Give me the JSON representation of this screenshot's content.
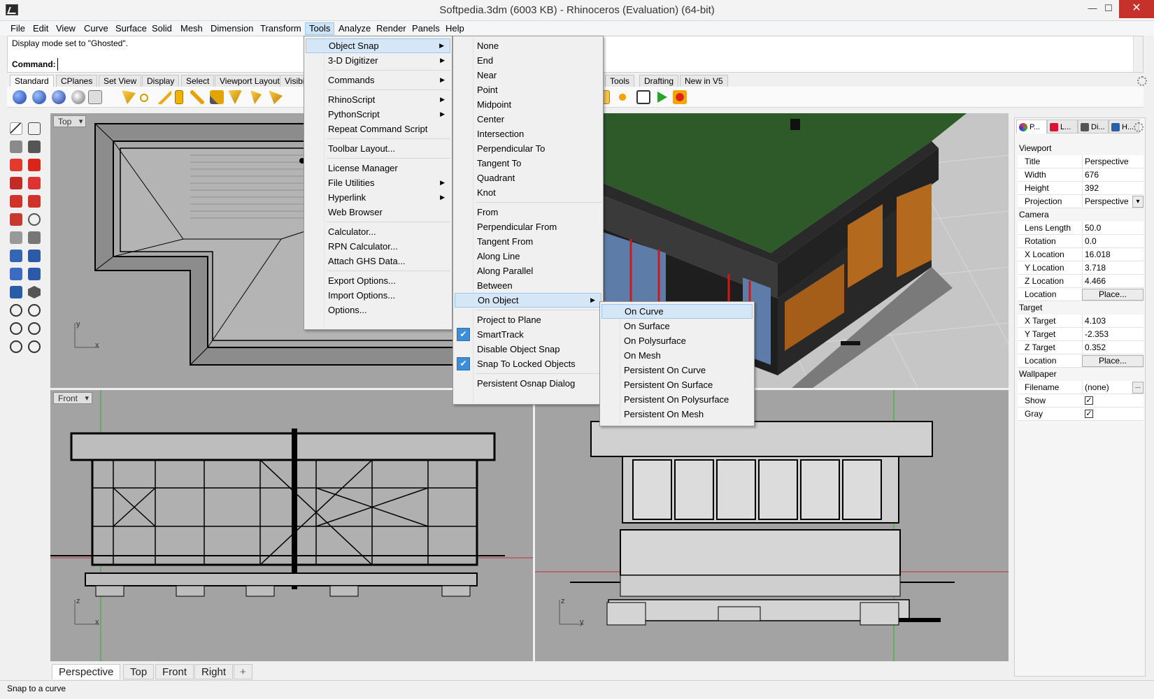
{
  "window": {
    "title": "Softpedia.3dm (6003 KB) - Rhinoceros (Evaluation) (64-bit)",
    "minimize_glyph": "—",
    "maximize_glyph": "☐",
    "close_glyph": "✕"
  },
  "menubar": [
    "File",
    "Edit",
    "View",
    "Curve",
    "Surface",
    "Solid",
    "Mesh",
    "Dimension",
    "Transform",
    "Tools",
    "Analyze",
    "Render",
    "Panels",
    "Help"
  ],
  "command": {
    "history": "Display mode set to \"Ghosted\".",
    "prompt": "Command:",
    "value": ""
  },
  "toolbar_tabs": [
    "Standard",
    "CPlanes",
    "Set View",
    "Display",
    "Select",
    "Viewport Layout",
    "Visibility",
    "Tools",
    "Drafting",
    "New in V5"
  ],
  "tools_menu": {
    "items": [
      {
        "label": "Object Snap",
        "submenu": true,
        "highlighted": true
      },
      {
        "label": "3-D Digitizer",
        "submenu": true
      },
      {
        "sep": true
      },
      {
        "label": "Commands",
        "submenu": true
      },
      {
        "sep": true
      },
      {
        "label": "RhinoScript",
        "submenu": true
      },
      {
        "label": "PythonScript",
        "submenu": true
      },
      {
        "label": "Repeat Command Script"
      },
      {
        "sep": true
      },
      {
        "label": "Toolbar Layout..."
      },
      {
        "sep": true
      },
      {
        "label": "License Manager"
      },
      {
        "label": "File Utilities",
        "submenu": true
      },
      {
        "label": "Hyperlink",
        "submenu": true
      },
      {
        "label": "Web Browser"
      },
      {
        "sep": true
      },
      {
        "label": "Calculator..."
      },
      {
        "label": "RPN Calculator..."
      },
      {
        "label": "Attach GHS Data..."
      },
      {
        "sep": true
      },
      {
        "label": "Export Options..."
      },
      {
        "label": "Import Options..."
      },
      {
        "label": "Options..."
      }
    ]
  },
  "osnap_menu": {
    "items": [
      {
        "label": "None"
      },
      {
        "label": "End"
      },
      {
        "label": "Near"
      },
      {
        "label": "Point"
      },
      {
        "label": "Midpoint"
      },
      {
        "label": "Center"
      },
      {
        "label": "Intersection"
      },
      {
        "label": "Perpendicular To"
      },
      {
        "label": "Tangent To"
      },
      {
        "label": "Quadrant"
      },
      {
        "label": "Knot"
      },
      {
        "sep": true
      },
      {
        "label": "From"
      },
      {
        "label": "Perpendicular From"
      },
      {
        "label": "Tangent From"
      },
      {
        "label": "Along Line"
      },
      {
        "label": "Along Parallel"
      },
      {
        "label": "Between"
      },
      {
        "label": "On Object",
        "submenu": true,
        "highlighted": true
      },
      {
        "sep": true
      },
      {
        "label": "Project to Plane"
      },
      {
        "label": "SmartTrack",
        "checked": true
      },
      {
        "label": "Disable Object Snap"
      },
      {
        "label": "Snap To Locked Objects",
        "checked": true
      },
      {
        "sep": true
      },
      {
        "label": "Persistent Osnap Dialog"
      }
    ]
  },
  "onobject_menu": {
    "items": [
      {
        "label": "On Curve",
        "highlighted": true
      },
      {
        "label": "On Surface"
      },
      {
        "label": "On Polysurface"
      },
      {
        "label": "On Mesh"
      },
      {
        "label": "Persistent On Curve"
      },
      {
        "label": "Persistent On Surface"
      },
      {
        "label": "Persistent On Polysurface"
      },
      {
        "label": "Persistent On Mesh"
      }
    ]
  },
  "viewports": {
    "top": {
      "label": "Top",
      "axis_a": "y",
      "axis_b": "x"
    },
    "front": {
      "label": "Front",
      "axis_a": "z",
      "axis_b": "x"
    },
    "right": {
      "axis_a": "z",
      "axis_b": "y"
    }
  },
  "viewport_tabs": [
    "Perspective",
    "Top",
    "Front",
    "Right",
    "+"
  ],
  "status": "Snap to a curve",
  "properties": {
    "tabs": [
      "P...",
      "L...",
      "Di...",
      "H..."
    ],
    "sections": [
      {
        "title": "Viewport",
        "rows": [
          {
            "key": "Title",
            "value": "Perspective"
          },
          {
            "key": "Width",
            "value": "676"
          },
          {
            "key": "Height",
            "value": "392"
          },
          {
            "key": "Projection",
            "value": "Perspective",
            "dropdown": true
          }
        ]
      },
      {
        "title": "Camera",
        "rows": [
          {
            "key": "Lens Length",
            "value": "50.0"
          },
          {
            "key": "Rotation",
            "value": "0.0"
          },
          {
            "key": "X Location",
            "value": "16.018"
          },
          {
            "key": "Y Location",
            "value": "3.718"
          },
          {
            "key": "Z Location",
            "value": "4.466"
          },
          {
            "key": "Location",
            "button": "Place..."
          }
        ]
      },
      {
        "title": "Target",
        "rows": [
          {
            "key": "X Target",
            "value": "4.103"
          },
          {
            "key": "Y Target",
            "value": "-2.353"
          },
          {
            "key": "Z Target",
            "value": "0.352"
          },
          {
            "key": "Location",
            "button": "Place..."
          }
        ]
      },
      {
        "title": "Wallpaper",
        "rows": [
          {
            "key": "Filename",
            "value": "(none)",
            "dots": true
          },
          {
            "key": "Show",
            "checkbox": true
          },
          {
            "key": "Gray",
            "checkbox": true
          }
        ]
      }
    ]
  },
  "colors": {
    "menu_highlight": "#d5e6f6",
    "check_blue": "#3c8ed8",
    "viewport_bg": "#a3a3a3",
    "roof_green": "#2e5a2a",
    "wall_orange": "#b36a1f"
  }
}
